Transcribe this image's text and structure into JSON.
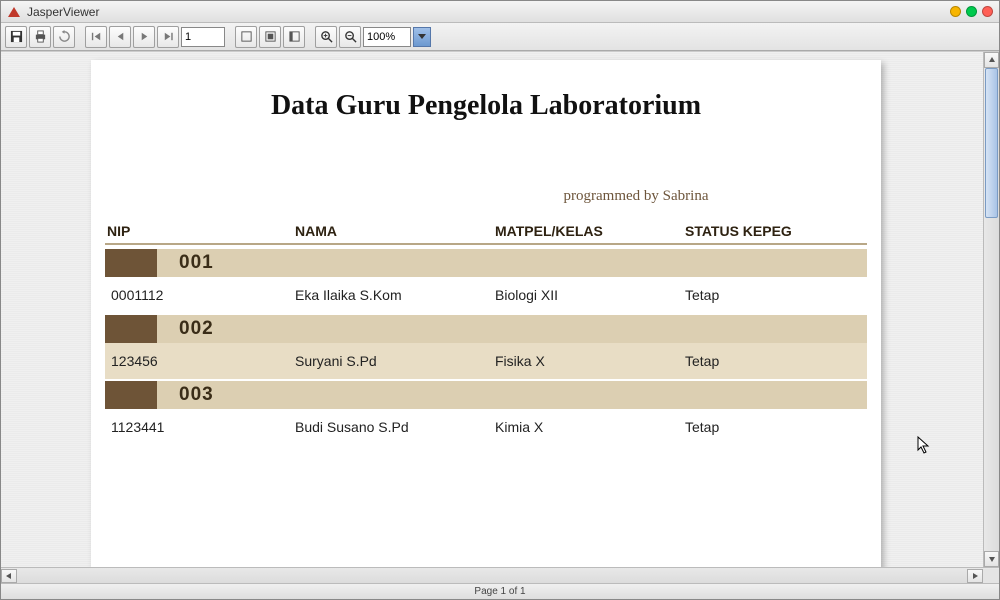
{
  "window": {
    "title": "JasperViewer"
  },
  "toolbar": {
    "page_value": "1",
    "zoom_value": "100%"
  },
  "status": {
    "text": "Page 1 of 1"
  },
  "report": {
    "title": "Data Guru Pengelola Laboratorium",
    "credit": "programmed by Sabrina",
    "columns": {
      "nip": "NIP",
      "nama": "NAMA",
      "matpel": "MATPEL/KELAS",
      "status": "STATUS KEPEG"
    },
    "groups": [
      {
        "num": "001",
        "nip": "0001112",
        "nama": "Eka Ilaika S.Kom",
        "matpel": "Biologi XII",
        "status": "Tetap",
        "shaded": false
      },
      {
        "num": "002",
        "nip": "123456",
        "nama": "Suryani S.Pd",
        "matpel": "Fisika X",
        "status": "Tetap",
        "shaded": true
      },
      {
        "num": "003",
        "nip": "1123441",
        "nama": "Budi Susano S.Pd",
        "matpel": "Kimia X",
        "status": "Tetap",
        "shaded": false
      }
    ]
  }
}
